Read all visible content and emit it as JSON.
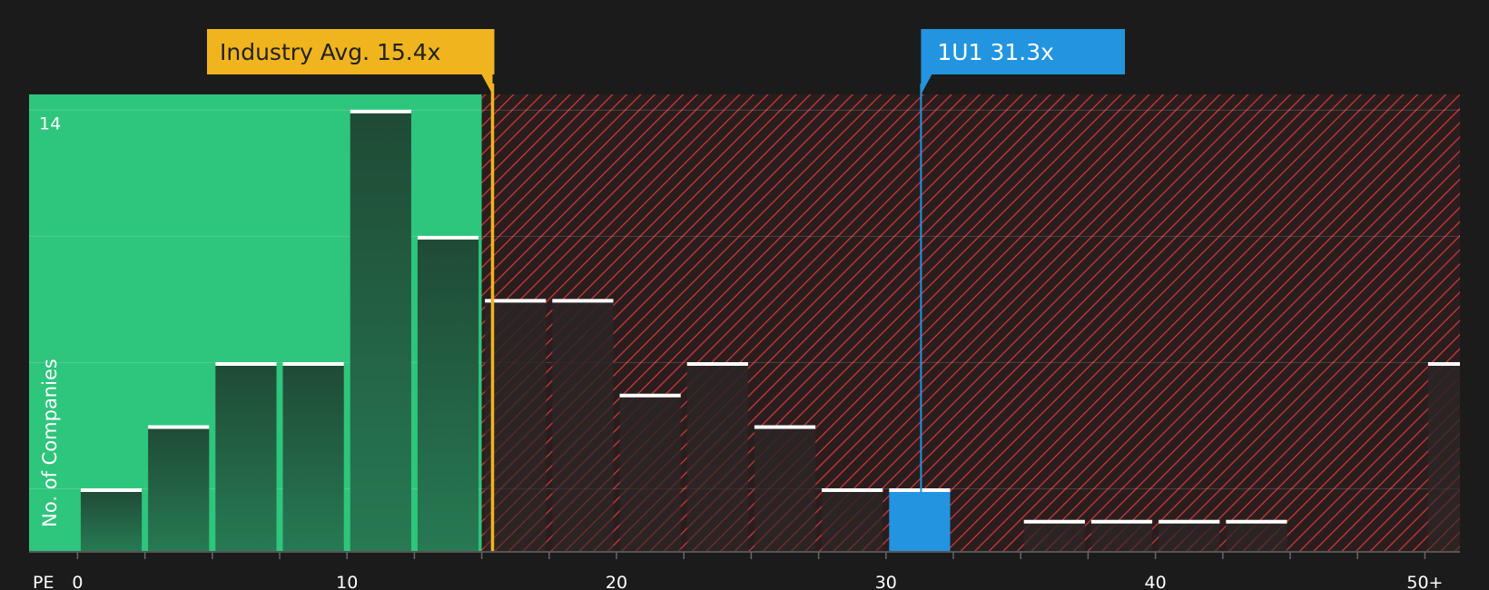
{
  "chart_data": {
    "type": "bar",
    "title": "",
    "xlabel": "PE",
    "ylabel": "No. of Companies",
    "x_ticks": [
      {
        "value": 0,
        "label": "0"
      },
      {
        "value": 10,
        "label": "10"
      },
      {
        "value": 20,
        "label": "20"
      },
      {
        "value": 30,
        "label": "30"
      },
      {
        "value": 40,
        "label": "40"
      },
      {
        "value": 50,
        "label": "50+"
      }
    ],
    "y_ticks": [
      {
        "value": 14,
        "label": "14"
      }
    ],
    "xlim": [
      -1.8,
      51.3
    ],
    "ylim": [
      0,
      14.5
    ],
    "bin_width": 2.5,
    "bins": [
      {
        "start": 0.0,
        "value": 2
      },
      {
        "start": 2.5,
        "value": 4
      },
      {
        "start": 5.0,
        "value": 6
      },
      {
        "start": 7.5,
        "value": 6
      },
      {
        "start": 10.0,
        "value": 14
      },
      {
        "start": 12.5,
        "value": 10
      },
      {
        "start": 15.0,
        "value": 8
      },
      {
        "start": 17.5,
        "value": 8
      },
      {
        "start": 20.0,
        "value": 5
      },
      {
        "start": 22.5,
        "value": 6
      },
      {
        "start": 25.0,
        "value": 4
      },
      {
        "start": 27.5,
        "value": 2
      },
      {
        "start": 30.0,
        "value": 2,
        "highlight": true
      },
      {
        "start": 35.0,
        "value": 1
      },
      {
        "start": 37.5,
        "value": 1
      },
      {
        "start": 40.0,
        "value": 1
      },
      {
        "start": 42.5,
        "value": 1
      },
      {
        "start": 50.0,
        "value": 6
      }
    ],
    "markers": [
      {
        "name": "industry-avg",
        "label": "Industry Avg. 15.4x",
        "value": 15.4,
        "color": "#f0b41e"
      },
      {
        "name": "company",
        "label": "1U1 31.3x",
        "value": 31.3,
        "color": "#2394e0"
      }
    ],
    "regions": {
      "undervalued_color": "#2ec57c",
      "overvalued_color": "#c0392b"
    },
    "grid": true
  }
}
